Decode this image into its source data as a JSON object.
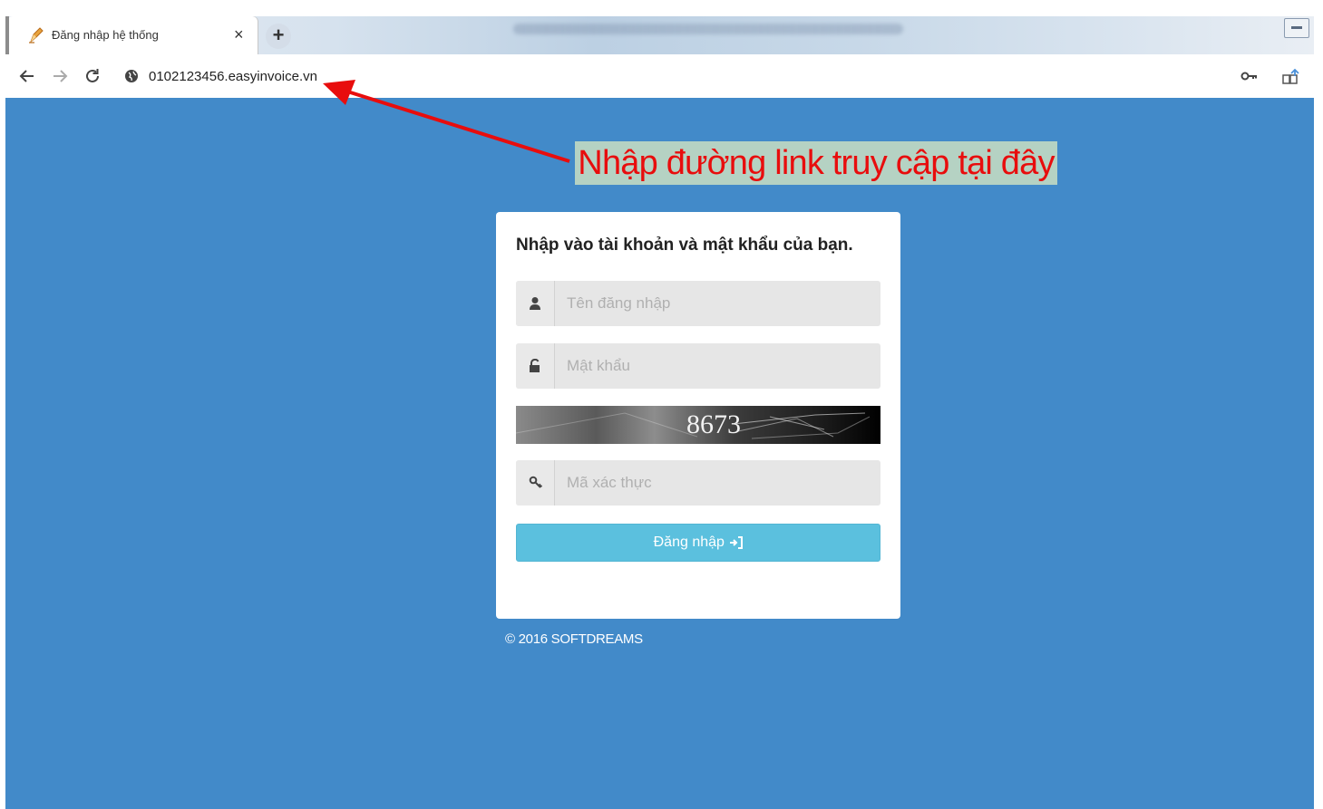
{
  "browser": {
    "tab": {
      "title": "Đăng nhập hệ thống",
      "close_label": "×"
    },
    "new_tab_label": "+",
    "address_bar": {
      "url": "0102123456.easyinvoice.vn"
    }
  },
  "annotation": {
    "text": "Nhập đường link truy cập tại đây",
    "text_color": "#e80d0d",
    "background_color": "#b5d2c3",
    "arrow_color": "#e80d0d"
  },
  "login": {
    "heading": "Nhập vào tài khoản và mật khẩu của bạn.",
    "username_placeholder": "Tên đăng nhập",
    "password_placeholder": "Mật khẩu",
    "captcha_text": "8673",
    "captcha_placeholder": "Mã xác thực",
    "login_button": "Đăng nhập"
  },
  "footer": {
    "copyright": "© 2016 SOFTDREAMS"
  },
  "colors": {
    "page_background": "#428ac9",
    "login_button": "#5bc0de"
  },
  "icons": {
    "favicon": "pen-icon",
    "site_info": "globe-icon",
    "saved_password": "key-icon",
    "extension": "extension-icon",
    "username": "user-icon",
    "password": "lock-icon",
    "captcha_field": "key-icon",
    "login": "sign-in-icon"
  }
}
